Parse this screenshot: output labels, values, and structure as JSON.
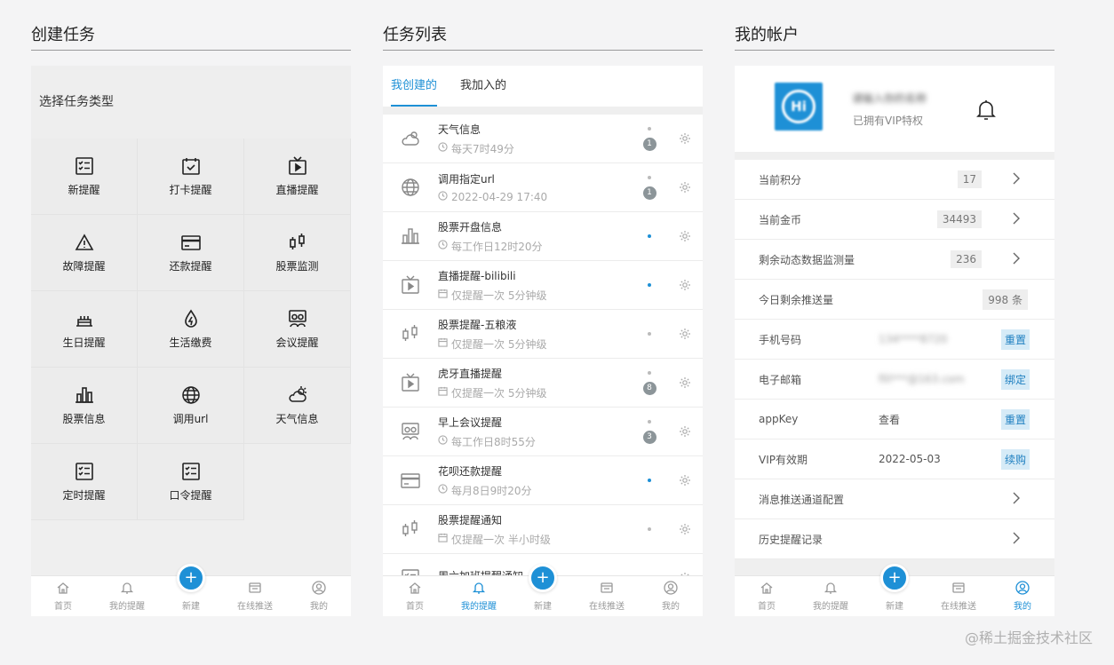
{
  "panel1": {
    "title": "创建任务",
    "section_label": "选择任务类型",
    "types": [
      {
        "label": "新提醒",
        "icon": "checklist-icon"
      },
      {
        "label": "打卡提醒",
        "icon": "calendar-check-icon"
      },
      {
        "label": "直播提醒",
        "icon": "tv-play-icon"
      },
      {
        "label": "故障提醒",
        "icon": "warning-icon"
      },
      {
        "label": "还款提醒",
        "icon": "credit-card-icon"
      },
      {
        "label": "股票监测",
        "icon": "candlestick-icon"
      },
      {
        "label": "生日提醒",
        "icon": "cake-icon"
      },
      {
        "label": "生活缴费",
        "icon": "drop-bolt-icon"
      },
      {
        "label": "会议提醒",
        "icon": "meeting-icon"
      },
      {
        "label": "股票信息",
        "icon": "bar-chart-icon"
      },
      {
        "label": "调用url",
        "icon": "globe-icon"
      },
      {
        "label": "天气信息",
        "icon": "weather-icon"
      },
      {
        "label": "定时提醒",
        "icon": "checklist-icon"
      },
      {
        "label": "口令提醒",
        "icon": "checklist-icon"
      }
    ]
  },
  "panel2": {
    "title": "任务列表",
    "tabs": [
      {
        "label": "我创建的"
      },
      {
        "label": "我加入的"
      }
    ],
    "tasks": [
      {
        "name": "天气信息",
        "sub": "每天7时49分",
        "icon": "weather-icon",
        "badge": "1"
      },
      {
        "name": "调用指定url",
        "sub": "2022-04-29 17:40",
        "icon": "globe-icon",
        "badge": "1"
      },
      {
        "name": "股票开盘信息",
        "sub": "每工作日12时20分",
        "icon": "bar-chart-icon",
        "badge": ""
      },
      {
        "name": "直播提醒-bilibili",
        "sub": "仅提醒一次 5分钟级",
        "icon": "tv-play-icon",
        "badge": ""
      },
      {
        "name": "股票提醒-五粮液",
        "sub": "仅提醒一次 5分钟级",
        "icon": "candlestick-icon",
        "badge": ""
      },
      {
        "name": "虎牙直播提醒",
        "sub": "仅提醒一次 5分钟级",
        "icon": "tv-play-icon",
        "badge": "8"
      },
      {
        "name": "早上会议提醒",
        "sub": "每工作日8时55分",
        "icon": "meeting-icon",
        "badge": "3"
      },
      {
        "name": "花呗还款提醒",
        "sub": "每月8日9时20分",
        "icon": "credit-card-icon",
        "badge": ""
      },
      {
        "name": "股票提醒通知",
        "sub": "仅提醒一次 半小时级",
        "icon": "candlestick-icon",
        "badge": ""
      },
      {
        "name": "周六加班提醒通知",
        "sub": "",
        "icon": "checklist-icon",
        "badge": ""
      }
    ]
  },
  "panel3": {
    "title": "我的帐户",
    "avatar_text": "Hi",
    "username": "请输入你的名称",
    "vip_text": "已拥有VIP特权",
    "rows": [
      {
        "label": "当前积分",
        "value": "17"
      },
      {
        "label": "当前金币",
        "value": "34493"
      },
      {
        "label": "剩余动态数据监测量",
        "value": "236"
      },
      {
        "label": "今日剩余推送量",
        "value": "998 条"
      },
      {
        "label": "手机号码",
        "middle": "134****8720",
        "button": "重置"
      },
      {
        "label": "电子邮箱",
        "middle": "fill***@163.com",
        "button": "绑定"
      },
      {
        "label": "appKey",
        "middle": "查看",
        "button": "重置"
      },
      {
        "label": "VIP有效期",
        "middle": "2022-05-03",
        "button": "续购"
      },
      {
        "label": "消息推送通道配置"
      },
      {
        "label": "历史提醒记录"
      }
    ]
  },
  "tabbar": {
    "items": [
      "首页",
      "我的提醒",
      "新建",
      "在线推送",
      "我的"
    ],
    "fab": "+"
  },
  "colors": {
    "accent": "#1e90d6",
    "badge": "#8c9599"
  },
  "watermark": "@稀土掘金技术社区"
}
